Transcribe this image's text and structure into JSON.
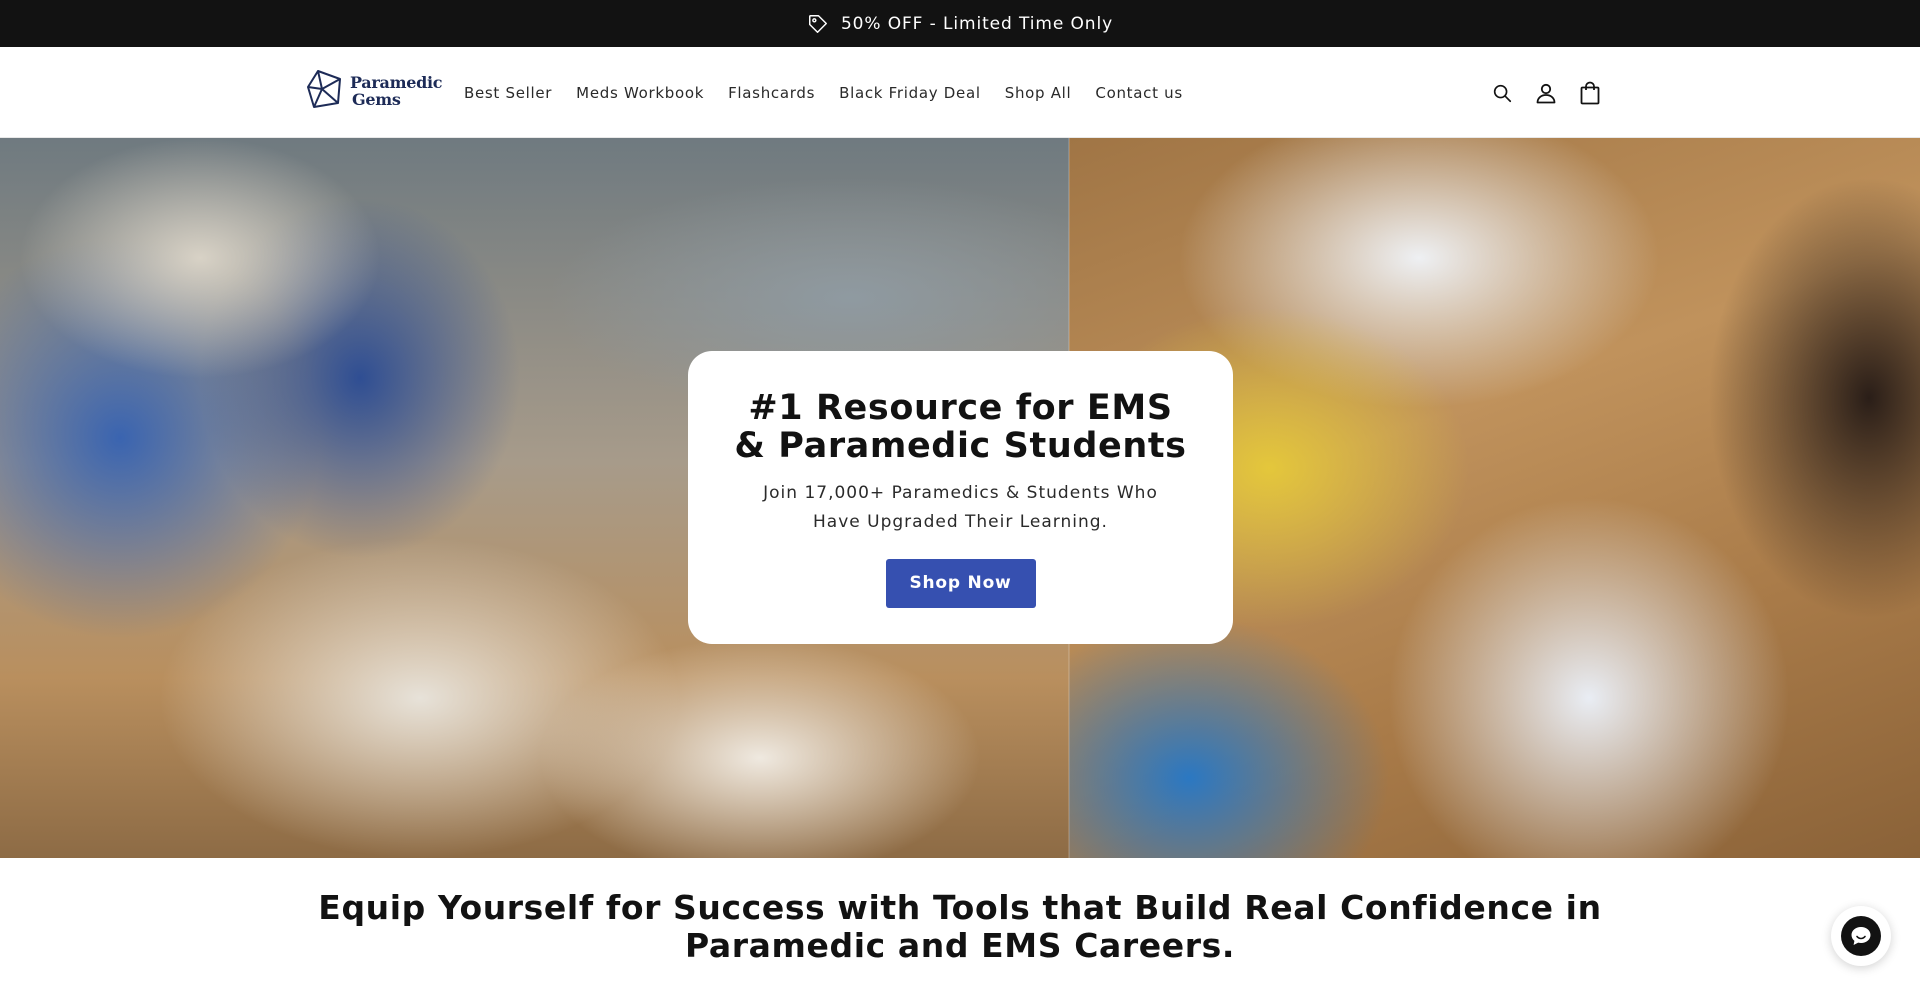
{
  "announcement": {
    "text": "50% OFF - Limited Time Only",
    "icon": "tag-icon"
  },
  "header": {
    "logo": {
      "line1": "Paramedic",
      "line2": "Gems",
      "icon": "gem-logo-icon"
    },
    "nav": [
      {
        "label": "Best Seller"
      },
      {
        "label": "Meds Workbook"
      },
      {
        "label": "Flashcards"
      },
      {
        "label": "Black Friday Deal"
      },
      {
        "label": "Shop All"
      },
      {
        "label": "Contact us"
      }
    ],
    "icons": [
      "search-icon",
      "account-icon",
      "cart-icon"
    ]
  },
  "hero": {
    "title": "#1 Resource for EMS & Paramedic Students",
    "subtitle": "Join 17,000+ Paramedics & Students Who Have Upgraded Their Learning.",
    "cta_label": "Shop Now"
  },
  "section": {
    "heading": "Equip Yourself for Success with Tools that Build Real Confidence in Paramedic and EMS Careers."
  },
  "chat": {
    "icon": "chat-icon"
  },
  "colors": {
    "announcement_bg": "#121212",
    "button_bg": "#3650b0",
    "logo": "#1d2b57"
  }
}
